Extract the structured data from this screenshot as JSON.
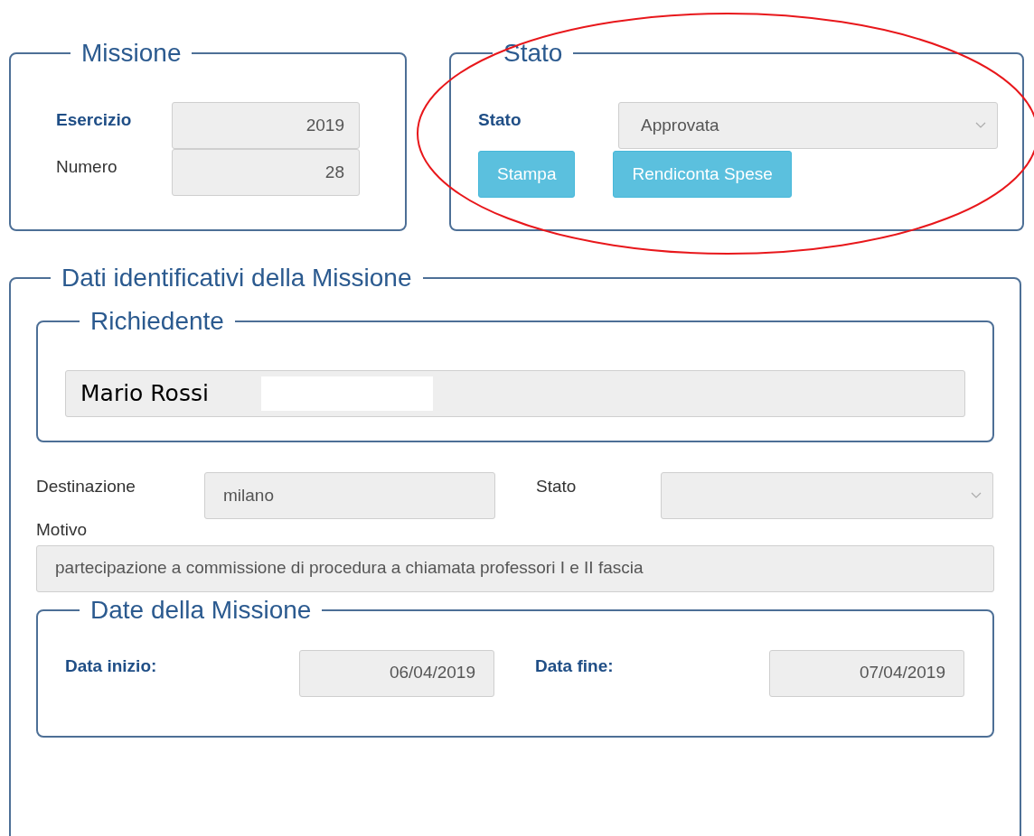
{
  "missione": {
    "title": "Missione",
    "fields": [
      {
        "label": "Esercizio",
        "value": "2019",
        "bold": true
      },
      {
        "label": "Numero",
        "value": "28",
        "bold": false
      }
    ]
  },
  "stato": {
    "title": "Stato",
    "label": "Stato",
    "value": "Approvata",
    "buttons": [
      "Stampa",
      "Rendiconta Spese"
    ]
  },
  "dati": {
    "title": "Dati identificativi della Missione",
    "richiedente": {
      "title": "Richiedente",
      "value": "Mario Rossi"
    },
    "destinazione": {
      "label": "Destinazione",
      "value": "milano"
    },
    "stato": {
      "label": "Stato"
    },
    "motivo": {
      "label": "Motivo",
      "value": "partecipazione a commissione di procedura a chiamata professori I e II fascia"
    },
    "date": {
      "title": "Date della Missione",
      "inizio": {
        "label": "Data inizio:",
        "value": "06/04/2019"
      },
      "fine": {
        "label": "Data fine:",
        "value": "07/04/2019"
      }
    }
  }
}
